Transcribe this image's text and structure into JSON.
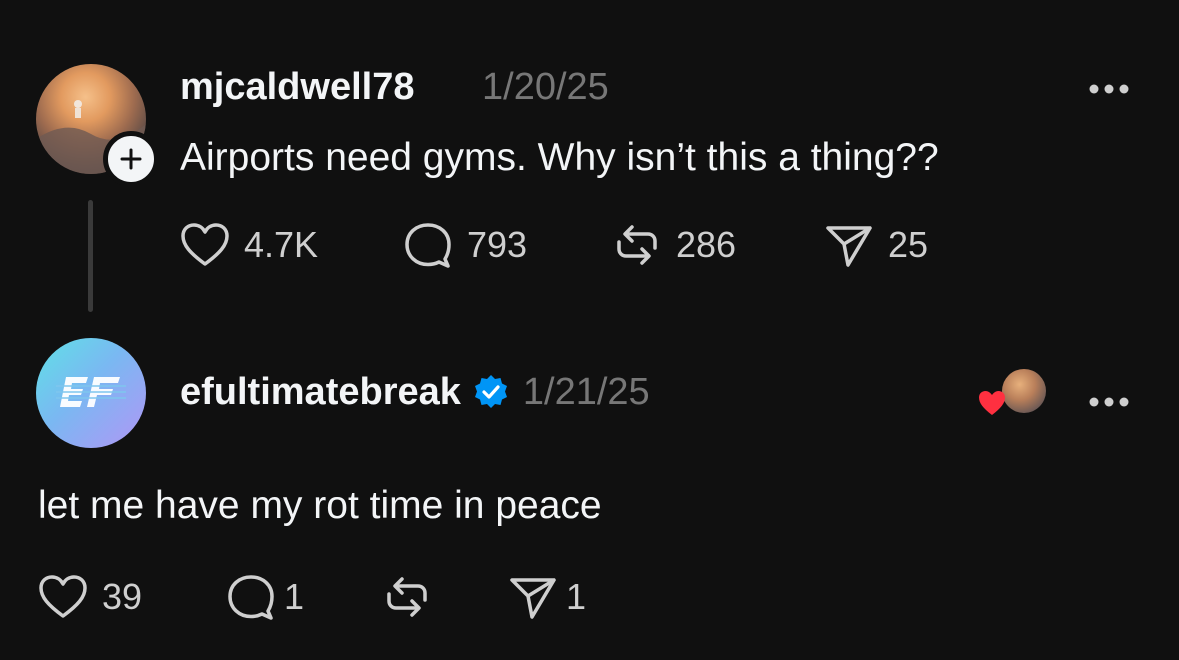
{
  "post": {
    "username": "mjcaldwell78",
    "date": "1/20/25",
    "text": "Airports need gyms. Why isn’t this a thing??",
    "likes": "4.7K",
    "replies": "793",
    "reposts": "286",
    "shares": "25"
  },
  "reply": {
    "username": "efultimatebreak",
    "date": "1/21/25",
    "text": "let me have my rot time in peace",
    "likes": "39",
    "replies": "1",
    "shares": "1",
    "verified": true
  },
  "colors": {
    "background": "#101010",
    "text": "#f3f5f7",
    "muted": "#777777",
    "verified": "#0095f6",
    "heart": "#ff3040"
  },
  "icons": [
    "heart-icon",
    "comment-icon",
    "repost-icon",
    "share-icon",
    "more-icon",
    "plus-icon",
    "verified-icon"
  ]
}
